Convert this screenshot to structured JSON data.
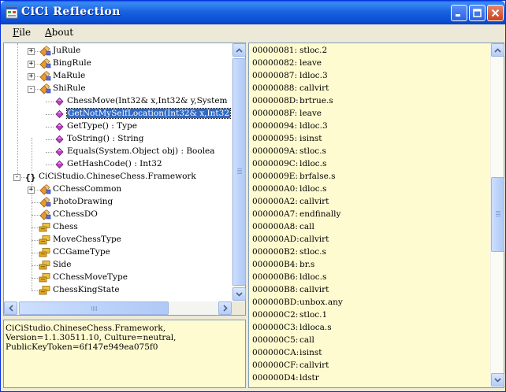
{
  "window": {
    "title": "CiCi Reflection"
  },
  "menu": [
    {
      "mnemonic": "F",
      "rest": "ile"
    },
    {
      "mnemonic": "A",
      "rest": "bout"
    }
  ],
  "tree": {
    "nodes": [
      {
        "label": "JuRule",
        "icon": "class-icon",
        "expander": "+"
      },
      {
        "label": "BingRule",
        "icon": "class-icon",
        "expander": "+"
      },
      {
        "label": "MaRule",
        "icon": "class-icon",
        "expander": "+"
      },
      {
        "label": "ShiRule",
        "icon": "class-icon",
        "expander": "-"
      },
      {
        "label": "ChessMove(Int32& x,Int32& y,System",
        "icon": "method-icon",
        "expander": ""
      },
      {
        "label": "GetNotMySelfLocation(Int32& x,Int32",
        "icon": "method-icon",
        "expander": "",
        "selected": true
      },
      {
        "label": "GetType() : Type",
        "icon": "method-icon",
        "expander": ""
      },
      {
        "label": "ToString() : String",
        "icon": "method-icon",
        "expander": ""
      },
      {
        "label": "Equals(System.Object obj) : Boolea",
        "icon": "method-icon",
        "expander": ""
      },
      {
        "label": "GetHashCode() : Int32",
        "icon": "method-icon",
        "expander": ""
      },
      {
        "label": "CiCiStudio.ChineseChess.Framework",
        "icon": "namespace-icon",
        "expander": "-"
      },
      {
        "label": "CChessCommon",
        "icon": "class-icon",
        "expander": "+"
      },
      {
        "label": "PhotoDrawing",
        "icon": "class-icon",
        "expander": ""
      },
      {
        "label": "CChessDO",
        "icon": "class-icon",
        "expander": ""
      },
      {
        "label": "Chess",
        "icon": "enum-icon",
        "expander": ""
      },
      {
        "label": "MoveChessType",
        "icon": "enum-icon",
        "expander": ""
      },
      {
        "label": "CCGameType",
        "icon": "enum-icon",
        "expander": ""
      },
      {
        "label": "Side",
        "icon": "enum-icon",
        "expander": ""
      },
      {
        "label": "CChessMoveType",
        "icon": "enum-icon",
        "expander": ""
      },
      {
        "label": "ChessKingState",
        "icon": "enum-icon",
        "expander": ""
      }
    ]
  },
  "info": {
    "lines": [
      "CiCiStudio.ChineseChess.Framework,",
      "Version=1.1.30511.10, Culture=neutral,",
      "PublicKeyToken=6f147e949ea075f0"
    ]
  },
  "il": [
    {
      "offset": "00000081:",
      "op": "stloc.2"
    },
    {
      "offset": "00000082:",
      "op": "leave"
    },
    {
      "offset": "00000087:",
      "op": "ldloc.3"
    },
    {
      "offset": "00000088:",
      "op": "callvirt"
    },
    {
      "offset": "0000008D:",
      "op": "brtrue.s"
    },
    {
      "offset": "0000008F:",
      "op": "leave"
    },
    {
      "offset": "00000094:",
      "op": "ldloc.3"
    },
    {
      "offset": "00000095:",
      "op": "isinst"
    },
    {
      "offset": "0000009A:",
      "op": "stloc.s"
    },
    {
      "offset": "0000009C:",
      "op": "ldloc.s"
    },
    {
      "offset": "0000009E:",
      "op": "brfalse.s"
    },
    {
      "offset": "000000A0:",
      "op": "ldloc.s"
    },
    {
      "offset": "000000A2:",
      "op": "callvirt"
    },
    {
      "offset": "000000A7:",
      "op": "endfinally"
    },
    {
      "offset": "000000A8:",
      "op": "call"
    },
    {
      "offset": "000000AD:",
      "op": "callvirt"
    },
    {
      "offset": "000000B2:",
      "op": "stloc.s"
    },
    {
      "offset": "000000B4:",
      "op": "br.s"
    },
    {
      "offset": "000000B6:",
      "op": "ldloc.s"
    },
    {
      "offset": "000000B8:",
      "op": "callvirt"
    },
    {
      "offset": "000000BD:",
      "op": "unbox.any"
    },
    {
      "offset": "000000C2:",
      "op": "stloc.1"
    },
    {
      "offset": "000000C3:",
      "op": "ldloca.s"
    },
    {
      "offset": "000000C5:",
      "op": "call"
    },
    {
      "offset": "000000CA:",
      "op": "isinst"
    },
    {
      "offset": "000000CF:",
      "op": "callvirt"
    },
    {
      "offset": "000000D4:",
      "op": "ldstr"
    }
  ],
  "colors": {
    "titlebar": "#0a55e0",
    "panel_bg": "#fffbd0",
    "selection": "#316ac5",
    "chrome": "#ece9d8"
  }
}
